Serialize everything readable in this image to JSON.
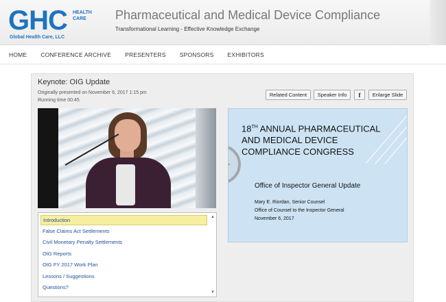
{
  "header": {
    "logo_main": "GHC",
    "logo_side": "HEALTH CARE",
    "logo_sub": "Global Health Care, LLC",
    "site_title": "Pharmaceutical and Medical Device Compliance",
    "tagline": "Transformational Learning - Effective Knowledge Exchange"
  },
  "nav": {
    "items": [
      {
        "label": "HOME"
      },
      {
        "label": "CONFERENCE ARCHIVE"
      },
      {
        "label": "PRESENTERS"
      },
      {
        "label": "SPONSORS"
      },
      {
        "label": "EXHIBITORS"
      }
    ]
  },
  "presentation": {
    "title": "Keynote: OIG Update",
    "presented": "Originally presented on November 6, 2017 1:15 pm",
    "running_time": "Running time 00:45",
    "buttons": {
      "related": "Related Content",
      "speaker": "Speaker Info",
      "facebook": "f",
      "enlarge": "Enlarge Slide"
    }
  },
  "slide": {
    "heading_prefix": "18",
    "heading_sup": "TH",
    "heading_rest": " ANNUAL PHARMACEUTICAL AND MEDICAL DEVICE COMPLIANCE CONGRESS",
    "subtitle": "Office of Inspector General Update",
    "line1": "Mary E. Riordan, Senior Counsel",
    "line2": "Office of Counsel to the Inspector General",
    "line3": "November 6, 2017"
  },
  "chapters": {
    "items": [
      {
        "label": "Introduction"
      },
      {
        "label": "False Claims Act Settlements"
      },
      {
        "label": "Civil Monetary Penalty Settlements"
      },
      {
        "label": "OIG Reports"
      },
      {
        "label": "OIG FY 2017 Work Plan"
      },
      {
        "label": "Lessons / Suggestions"
      },
      {
        "label": "Questions?"
      }
    ]
  },
  "icons": {
    "play": "play-icon",
    "scroll_up": "scroll-up-icon",
    "scroll_down": "scroll-down-icon"
  },
  "colors": {
    "brand_blue": "#1e73be",
    "link_blue": "#1e4f9a",
    "active_chapter": "#f8eea0",
    "slide_bg": "#cde3f4"
  }
}
